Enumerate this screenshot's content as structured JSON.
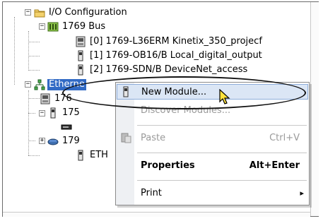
{
  "tree": {
    "io_configuration": "I/O Configuration",
    "bus": "1769 Bus",
    "modules": [
      "[0] 1769-L36ERM Kinetix_350_projecf",
      "[1] 1769-OB16/B Local_digital_output",
      "[2] 1769-SDN/B DeviceNet_access"
    ],
    "ethernet": "Etherne",
    "child1": "176",
    "child2": "175",
    "child3": "179",
    "child4": "ETH"
  },
  "context_menu": {
    "new_module": "New Module...",
    "discover_modules": "Discover Modules...",
    "paste": "Paste",
    "paste_shortcut": "Ctrl+V",
    "properties": "Properties",
    "properties_shortcut": "Alt+Enter",
    "print": "Print",
    "print_arrow": "▸"
  },
  "colors": {
    "selection": "#316ac5",
    "menu_highlight": "#dbe6f5",
    "disabled_text": "#9a9a9a"
  }
}
